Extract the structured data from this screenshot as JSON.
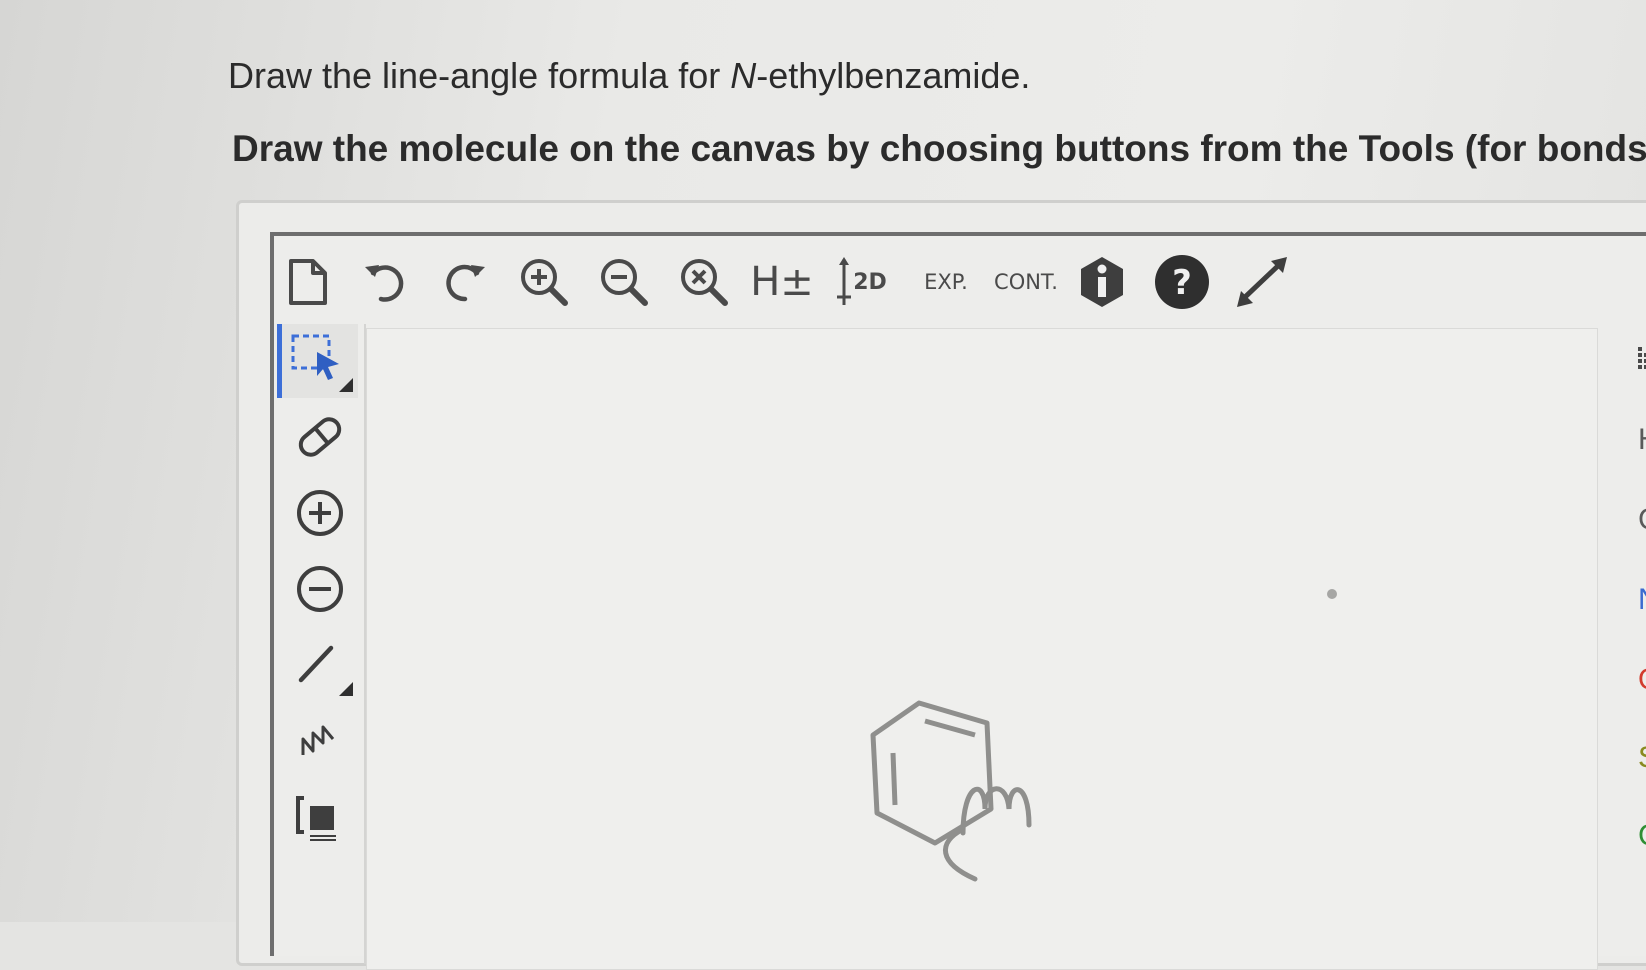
{
  "question": {
    "prefix": "Draw the line-angle formula for ",
    "italic": "N",
    "suffix": "-ethylbenzamide."
  },
  "instructions": "Draw the molecule on the canvas by choosing buttons from the Tools (for bonds)",
  "toolbar": {
    "h_label": "H±",
    "two_d_label": "2D",
    "exp_label": "EXP.",
    "cont_label": "CONT."
  },
  "icons": {
    "new": "document-icon",
    "undo": "undo-icon",
    "redo": "redo-icon",
    "zoom_in": "zoom-in-icon",
    "zoom_out": "zoom-out-icon",
    "zoom_reset": "zoom-reset-icon",
    "info": "info-icon",
    "help": "help-icon",
    "fullscreen": "expand-icon",
    "select": "lasso-select-icon",
    "erase": "eraser-icon",
    "charge_plus": "plus-charge-icon",
    "charge_minus": "minus-charge-icon",
    "bond": "single-bond-icon",
    "chain": "chain-icon",
    "bracket": "bracket-icon",
    "ring": "benzene-ring-icon",
    "periodic": "periodic-table-icon"
  },
  "elements": [
    "H",
    "C",
    "N",
    "O",
    "S",
    "Cl"
  ],
  "colors": {
    "accent": "#3d6fd8",
    "nitrogen": "#3a6bd0",
    "oxygen": "#d23b2e",
    "sulfur": "#8a8a20",
    "chlorine": "#2f8f35",
    "icon_dark": "#4a4a4a"
  }
}
